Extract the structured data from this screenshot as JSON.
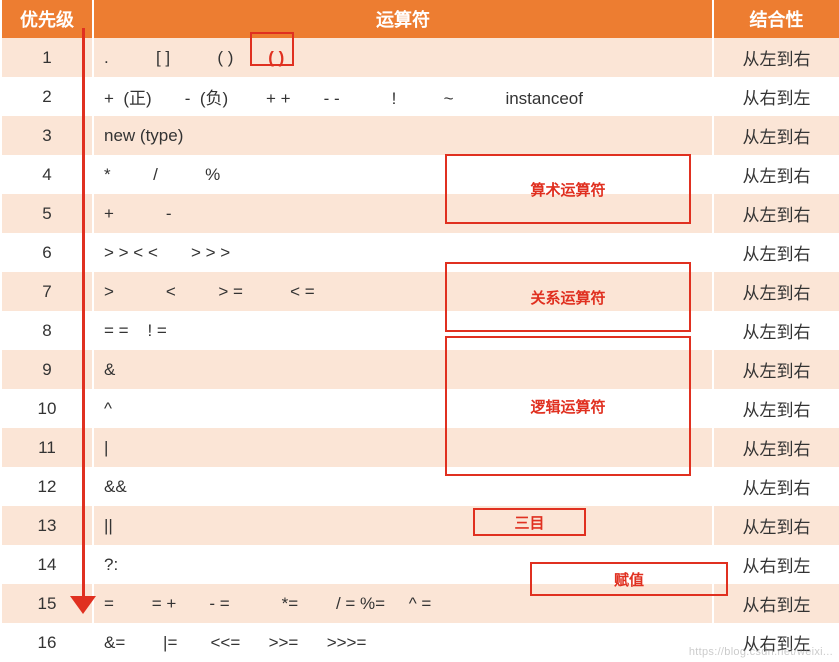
{
  "headers": {
    "priority": "优先级",
    "operator": "运算符",
    "assoc": "结合性"
  },
  "paren_red": "( )",
  "rows": [
    {
      "n": "1",
      "op": ".          [ ]          ( )    ",
      "assoc": "从左到右",
      "extra_paren": true
    },
    {
      "n": "2",
      "op": "+  (正)       -  (负)        + +       - -           !          ~           instanceof",
      "assoc": "从右到左"
    },
    {
      "n": "3",
      "op": "new (type)",
      "assoc": "从左到右"
    },
    {
      "n": "4",
      "op": "*         /          %",
      "assoc": "从左到右"
    },
    {
      "n": "5",
      "op": "+           -",
      "assoc": "从左到右"
    },
    {
      "n": "6",
      "op": "> > < <       > > >",
      "assoc": "从左到右"
    },
    {
      "n": "7",
      "op": ">           <         > =          < =",
      "assoc": "从左到右"
    },
    {
      "n": "8",
      "op": "= =    ! =",
      "assoc": "从左到右"
    },
    {
      "n": "9",
      "op": "&",
      "assoc": "从左到右"
    },
    {
      "n": "10",
      "op": "^",
      "assoc": "从左到右"
    },
    {
      "n": "11",
      "op": "|",
      "assoc": "从左到右"
    },
    {
      "n": "12",
      "op": "&&",
      "assoc": "从左到右"
    },
    {
      "n": "13",
      "op": "||",
      "assoc": "从左到右"
    },
    {
      "n": "14",
      "op": "?:",
      "assoc": "从右到左"
    },
    {
      "n": "15",
      "op": "=        = +       - =           *=        / = %=     ^ =",
      "assoc": "从右到左"
    },
    {
      "n": "16",
      "op": "&=        |=       <<=      >>=      >>>=",
      "assoc": "从右到左"
    }
  ],
  "annotations": {
    "arith": "算术运算符",
    "rel": "关系运算符",
    "logic": "逻辑运算符",
    "tern": "三目",
    "asgn": "赋值"
  },
  "watermark": "https://blog.csdn.net/weixi..."
}
